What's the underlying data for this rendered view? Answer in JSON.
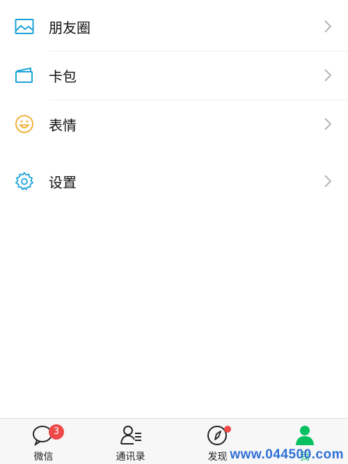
{
  "menu": {
    "items": [
      {
        "label": "朋友圈",
        "icon": "photo-icon"
      },
      {
        "label": "卡包",
        "icon": "card-icon"
      },
      {
        "label": "表情",
        "icon": "smiley-icon"
      },
      {
        "label": "设置",
        "icon": "gear-icon"
      }
    ]
  },
  "tabbar": {
    "tabs": [
      {
        "label": "微信",
        "icon": "chat-icon",
        "badge": "3"
      },
      {
        "label": "通讯录",
        "icon": "contacts-icon"
      },
      {
        "label": "发现",
        "icon": "compass-icon"
      },
      {
        "label": "我",
        "icon": "person-icon",
        "active": true
      }
    ]
  },
  "colors": {
    "active_tab": "#07c160",
    "badge": "#f04848",
    "icon_blue": "#1aa3d8",
    "icon_yellow": "#f0b23c"
  },
  "watermark": "www.044500.com"
}
